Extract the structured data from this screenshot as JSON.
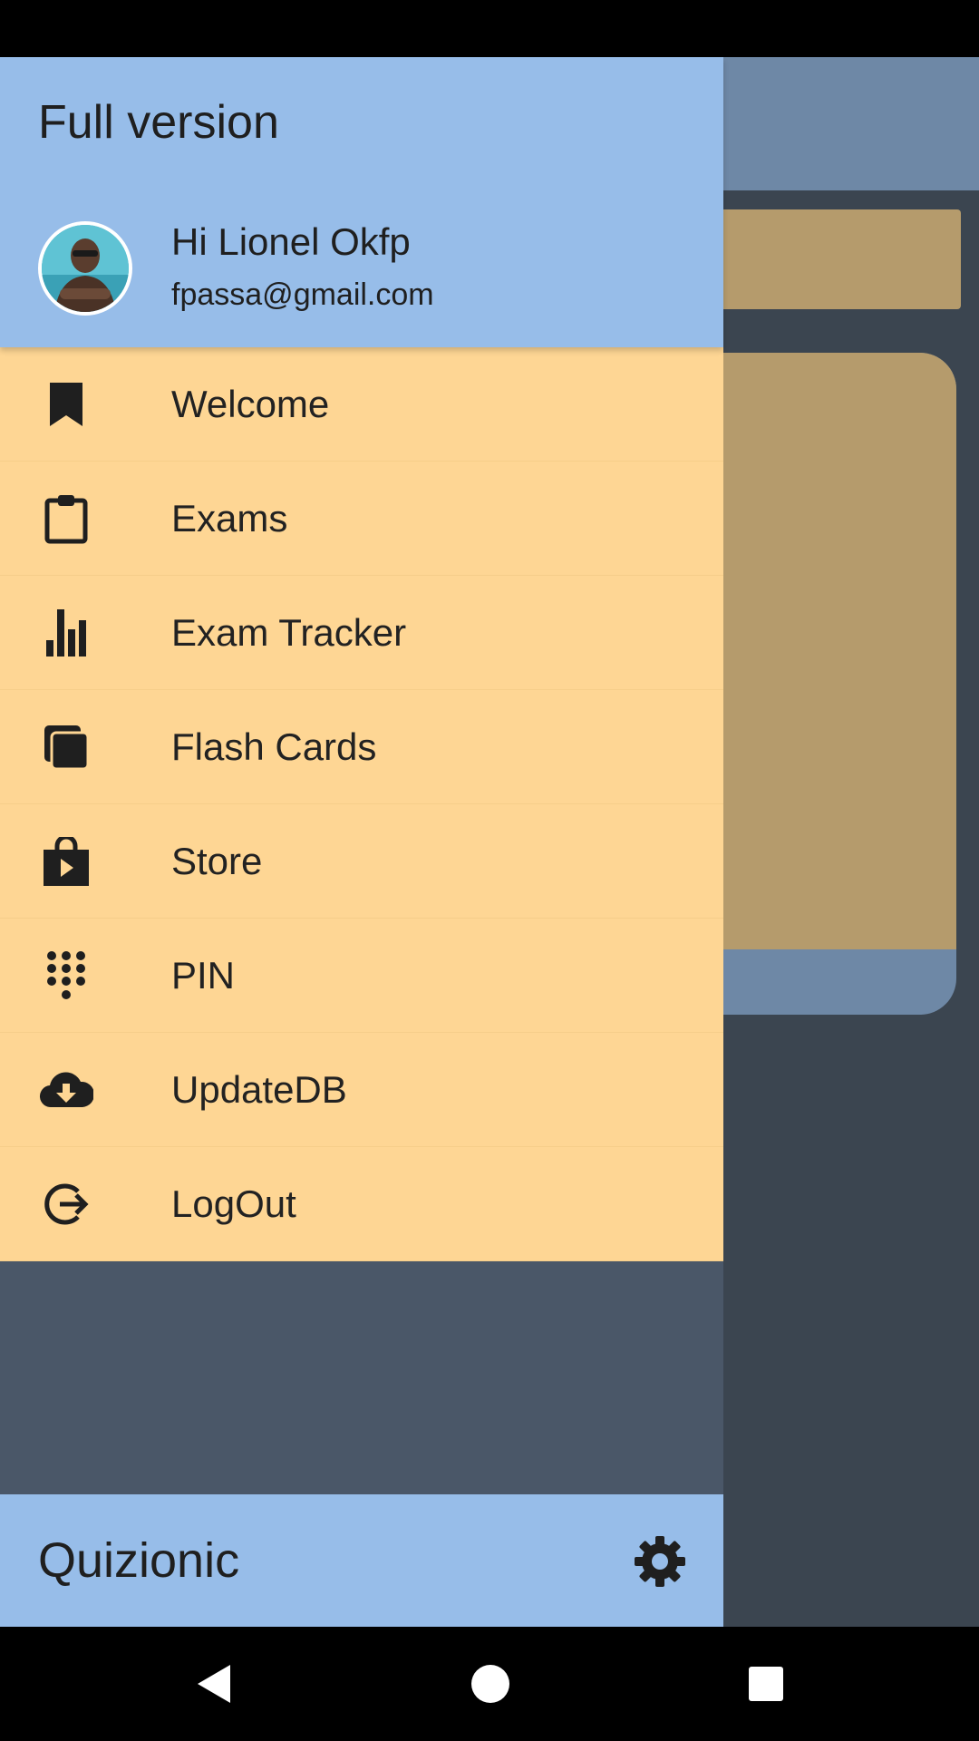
{
  "drawer": {
    "title": "Full version",
    "user": {
      "greeting": "Hi Lionel Okfp",
      "email": "fpassa@gmail.com"
    },
    "items": [
      {
        "label": "Welcome",
        "icon": "bookmark-icon"
      },
      {
        "label": "Exams",
        "icon": "clipboard-icon"
      },
      {
        "label": "Exam Tracker",
        "icon": "bar-chart-icon"
      },
      {
        "label": "Flash Cards",
        "icon": "cards-icon"
      },
      {
        "label": "Store",
        "icon": "shop-bag-icon"
      },
      {
        "label": "PIN",
        "icon": "dialpad-icon"
      },
      {
        "label": "UpdateDB",
        "icon": "cloud-download-icon"
      },
      {
        "label": "LogOut",
        "icon": "logout-icon"
      }
    ],
    "footer": {
      "app_name": "Quizionic",
      "settings_icon": "gear-icon"
    }
  },
  "colors": {
    "header": "#97bde9",
    "menu_item": "#fed694",
    "drawer_bg": "#4a5768"
  }
}
